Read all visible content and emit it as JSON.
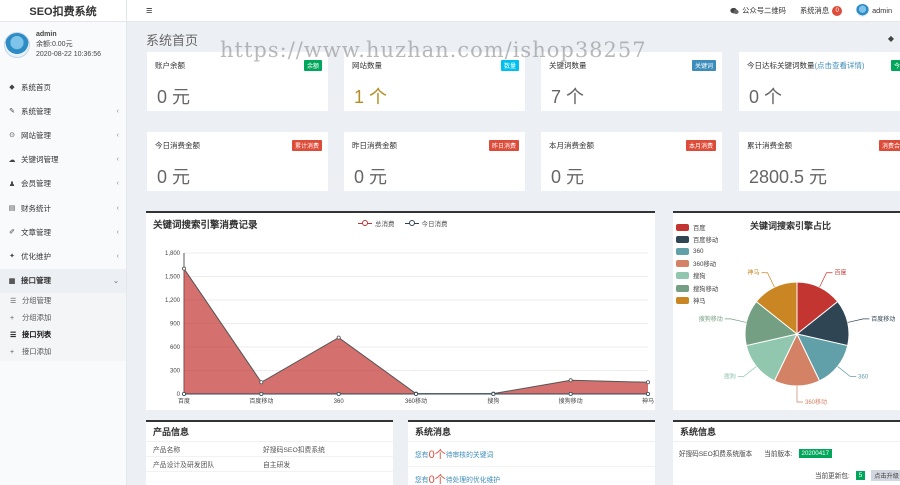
{
  "app": {
    "title": "SEO扣费系统"
  },
  "user": {
    "name": "admin",
    "balance": "余额:0.00元",
    "datetime": "2020-08-22 10:36:56"
  },
  "topbar": {
    "menu_icon": "≡",
    "wechat_label": "公众号二维码",
    "messages_label": "系统消息",
    "messages_count": "0",
    "user_name": "admin"
  },
  "sidebar": {
    "items": [
      {
        "label": "系统首页",
        "icon": "◆",
        "has_chevron": false
      },
      {
        "label": "系统管理",
        "icon": "✎",
        "has_chevron": true
      },
      {
        "label": "网站管理",
        "icon": "⊙",
        "has_chevron": true
      },
      {
        "label": "关键词管理",
        "icon": "☁",
        "has_chevron": true
      },
      {
        "label": "会员管理",
        "icon": "♟",
        "has_chevron": true
      },
      {
        "label": "财务统计",
        "icon": "▤",
        "has_chevron": true
      },
      {
        "label": "文章管理",
        "icon": "✐",
        "has_chevron": true
      },
      {
        "label": "优化维护",
        "icon": "✦",
        "has_chevron": true
      },
      {
        "label": "接口管理",
        "icon": "▦",
        "has_chevron": true
      }
    ],
    "submenu": [
      {
        "label": "分组管理",
        "icon": "☰",
        "active": false
      },
      {
        "label": "分组添加",
        "icon": "+",
        "active": false
      },
      {
        "label": "接口列表",
        "icon": "☰",
        "active": true
      },
      {
        "label": "接口添加",
        "icon": "+",
        "active": false
      }
    ]
  },
  "page": {
    "title": "系统首页",
    "watermark": "https://www.huzhan.com/ishop38257"
  },
  "stats": [
    {
      "title": "账户余额",
      "badge": "余额",
      "badge_color": "#00a65a",
      "value": "0 元"
    },
    {
      "title": "网站数量",
      "badge": "数量",
      "badge_color": "#00c0ef",
      "value": "1 个"
    },
    {
      "title": "关键词数量",
      "badge": "关键词",
      "badge_color": "#3c8dbc",
      "value": "7 个"
    },
    {
      "title": "今日达标关键词数量",
      "link": "(点击查看详情)",
      "badge": "今日达",
      "badge_color": "#00a65a",
      "value": "0 个"
    },
    {
      "title": "今日消费金额",
      "badge": "累计消费",
      "badge_color": "#dd4b39",
      "value": "0 元"
    },
    {
      "title": "昨日消费金额",
      "badge": "昨日消费",
      "badge_color": "#dd4b39",
      "value": "0 元"
    },
    {
      "title": "本月消费金额",
      "badge": "本月消费",
      "badge_color": "#dd4b39",
      "value": "0 元"
    },
    {
      "title": "累计消费金额",
      "badge": "消费合",
      "badge_color": "#dd4b39",
      "value": "2800.5 元"
    }
  ],
  "chart_data": [
    {
      "type": "area",
      "title": "关键词搜索引擎消费记录",
      "categories": [
        "百度",
        "百度移动",
        "360",
        "360移动",
        "搜狗",
        "搜狗移动",
        "神马"
      ],
      "series": [
        {
          "name": "总消费",
          "values": [
            1600,
            150,
            720,
            5,
            5,
            175,
            150
          ],
          "color": "#c23531"
        },
        {
          "name": "今日消费",
          "values": [
            0,
            0,
            0,
            0,
            0,
            0,
            0
          ],
          "color": "#2f4554"
        }
      ],
      "y_ticks": [
        "0",
        "300",
        "600",
        "900",
        "1,200",
        "1,500",
        "1,800"
      ],
      "ylim": [
        0,
        1800
      ],
      "grid": true,
      "legend": "top-center"
    },
    {
      "type": "pie",
      "title": "关键词搜索引擎占比",
      "slices": [
        {
          "name": "百度",
          "value": 1,
          "color": "#c23531"
        },
        {
          "name": "百度移动",
          "value": 1,
          "color": "#2f4554"
        },
        {
          "name": "360",
          "value": 1,
          "color": "#61a0a8"
        },
        {
          "name": "360移动",
          "value": 1,
          "color": "#d48265"
        },
        {
          "name": "搜狗",
          "value": 1,
          "color": "#91c7ae"
        },
        {
          "name": "搜狗移动",
          "value": 1,
          "color": "#749f83"
        },
        {
          "name": "神马",
          "value": 1,
          "color": "#ca8622"
        }
      ],
      "legend": "top-left"
    }
  ],
  "product_info": {
    "title": "产品信息",
    "rows": [
      {
        "key": "产品名称",
        "value": "好搜码SEO扣费系统"
      },
      {
        "key": "产品设计及研发团队",
        "value": "自主研发"
      }
    ]
  },
  "system_messages": {
    "title": "系统消息",
    "rows": [
      {
        "prefix": "您有",
        "count": "0个",
        "text": "待审核的关键词"
      },
      {
        "prefix": "您有",
        "count": "0个",
        "text": "待处理的优化维护"
      }
    ]
  },
  "system_info": {
    "title": "系统信息",
    "version_label": "好搜码SEO扣费系统版本",
    "current_label": "当前版本:",
    "version": "20200417",
    "update_label": "当前更新包:",
    "update_count": "5",
    "update_button": "点击升级"
  }
}
